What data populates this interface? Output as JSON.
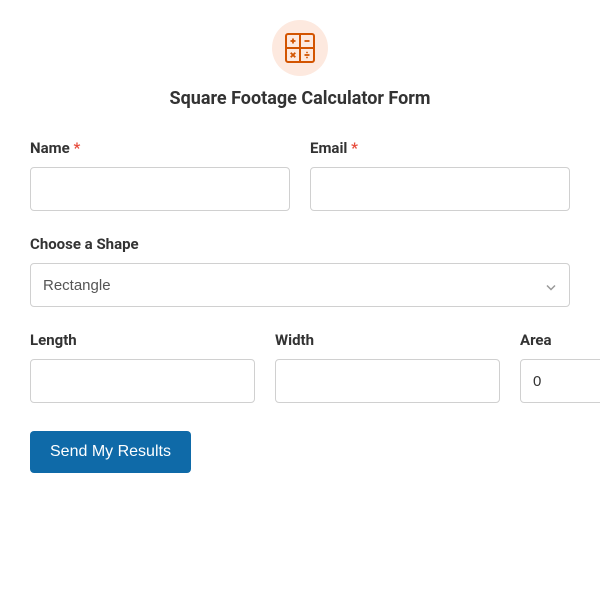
{
  "form": {
    "title": "Square Footage Calculator Form",
    "name_label": "Name",
    "email_label": "Email",
    "shape_label": "Choose a Shape",
    "shape_value": "Rectangle",
    "length_label": "Length",
    "width_label": "Width",
    "area_label": "Area",
    "area_value": "0",
    "submit_label": "Send My Results",
    "required_mark": "*"
  }
}
